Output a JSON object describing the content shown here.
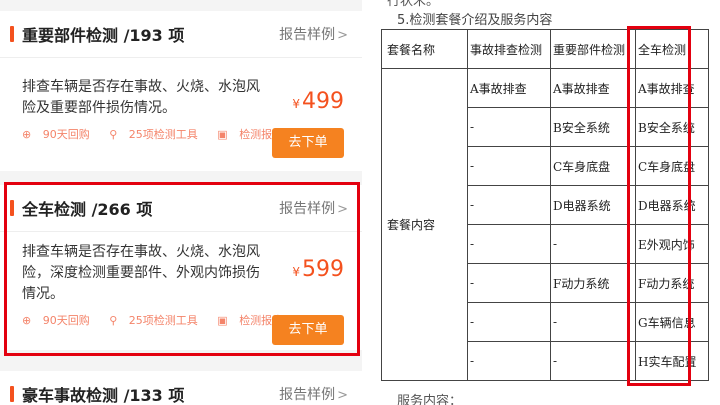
{
  "left": {
    "cards": [
      {
        "title": "重要部件检测 /193 项",
        "report_link": "报告样例",
        "description": "排查车辆是否存在事故、火烧、水泡风险及重要部件损伤情况。",
        "price_symbol": "¥",
        "price": "499",
        "features": [
          "90天回购",
          "25项检测工具",
          "检测报告"
        ],
        "order_button": "去下单"
      },
      {
        "title": "全车检测 /266 项",
        "report_link": "报告样例",
        "description": "排查车辆是否存在事故、火烧、水泡风险，深度检测重要部件、外观内饰损伤情况。",
        "price_symbol": "¥",
        "price": "599",
        "features": [
          "90天回购",
          "25项检测工具",
          "检测报告"
        ],
        "order_button": "去下单"
      },
      {
        "title": "豪车事故检测 /133 项",
        "report_link": "报告样例"
      }
    ]
  },
  "right": {
    "cut_text": "行状禾。",
    "section_heading": "5.检测套餐介绍及服务内容",
    "table": {
      "headers": [
        "套餐名称",
        "事故排查检测",
        "重要部件检测",
        "全车检测"
      ],
      "row_label": "套餐内容",
      "rows": [
        [
          "A事故排查",
          "A事故排查",
          "A事故排查"
        ],
        [
          "-",
          "B安全系统",
          "B安全系统"
        ],
        [
          "-",
          "C车身底盘",
          "C车身底盘"
        ],
        [
          "-",
          "D电器系统",
          "D电器系统"
        ],
        [
          "-",
          "-",
          "E外观内饰"
        ],
        [
          "-",
          "F动力系统",
          "F动力系统"
        ],
        [
          "-",
          "-",
          "G车辆信息"
        ],
        [
          "-",
          "-",
          "H实车配置"
        ]
      ]
    },
    "service_label": "服务内容："
  },
  "colors": {
    "accent": "#f4511e",
    "order_button": "#f58220",
    "highlight": "#e3000f",
    "feature_text": "#f4846a"
  },
  "icons": [
    "return-icon",
    "tools-icon",
    "report-icon"
  ]
}
